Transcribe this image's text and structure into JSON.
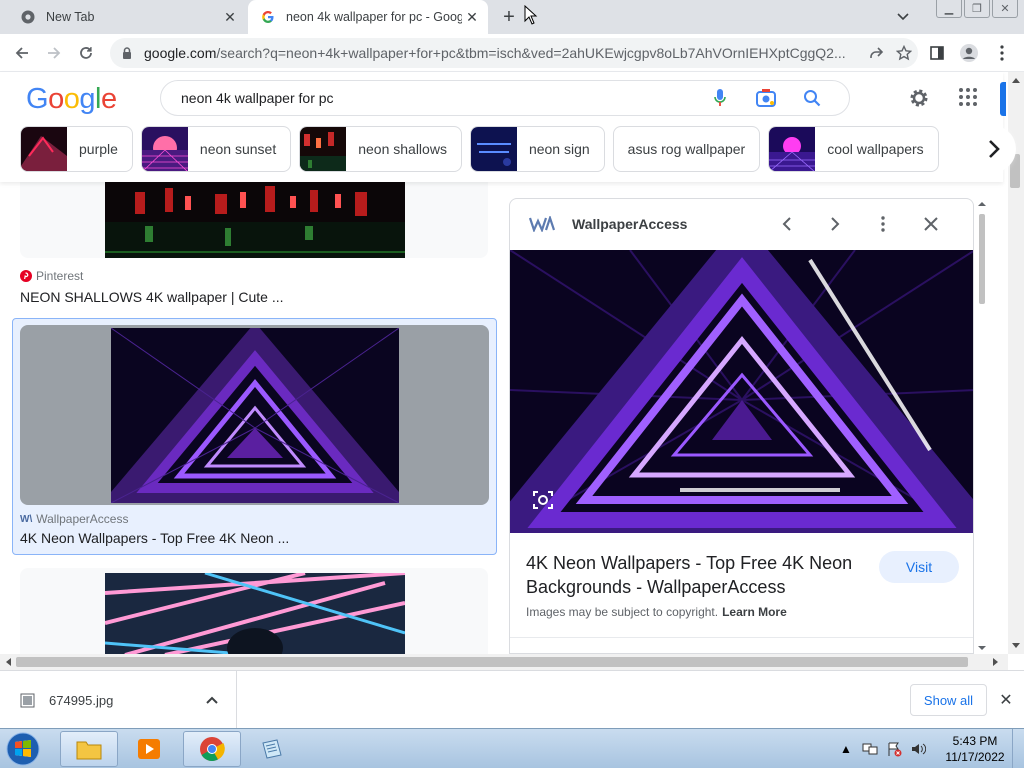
{
  "browser": {
    "tabs": [
      {
        "title": "New Tab",
        "active": false
      },
      {
        "title": "neon 4k wallpaper for pc - Goog",
        "active": true
      }
    ],
    "url_host": "google.com",
    "url_rest": "/search?q=neon+4k+wallpaper+for+pc&tbm=isch&ved=2ahUKEwjcgpv8oLb7AhVOrnIEHXptCggQ2..."
  },
  "google": {
    "logo_letters": [
      "G",
      "o",
      "o",
      "g",
      "l",
      "e"
    ],
    "query": "neon 4k wallpaper for pc",
    "chips": [
      {
        "label": "purple",
        "color": "#7a1f3d"
      },
      {
        "label": "neon sunset",
        "color": "#b0419d"
      },
      {
        "label": "neon shallows",
        "color": "#3b1b1b"
      },
      {
        "label": "neon sign",
        "color": "#2a3aa0"
      },
      {
        "label": "asus rog wallpaper",
        "color": ""
      },
      {
        "label": "cool wallpapers",
        "color": "#6a2aa8"
      }
    ]
  },
  "results": {
    "item1": {
      "source": "Pinterest",
      "title": "NEON SHALLOWS 4K wallpaper | Cute ..."
    },
    "item2": {
      "source": "WallpaperAccess",
      "title": "4K Neon Wallpapers - Top Free 4K Neon ..."
    }
  },
  "preview": {
    "logo_text": "WA",
    "site": "WallpaperAccess",
    "title": "4K Neon Wallpapers - Top Free 4K Neon Backgrounds - WallpaperAccess",
    "visit_label": "Visit",
    "copyright": "Images may be subject to copyright.",
    "learn_more": "Learn More"
  },
  "download": {
    "filename": "674995.jpg",
    "show_all": "Show all"
  },
  "taskbar": {
    "time": "5:43 PM",
    "date": "11/17/2022"
  },
  "colors": {
    "accent": "#1a73e8",
    "selected_bg": "#e8f0fe",
    "neon_purple": "#8a2be2"
  }
}
